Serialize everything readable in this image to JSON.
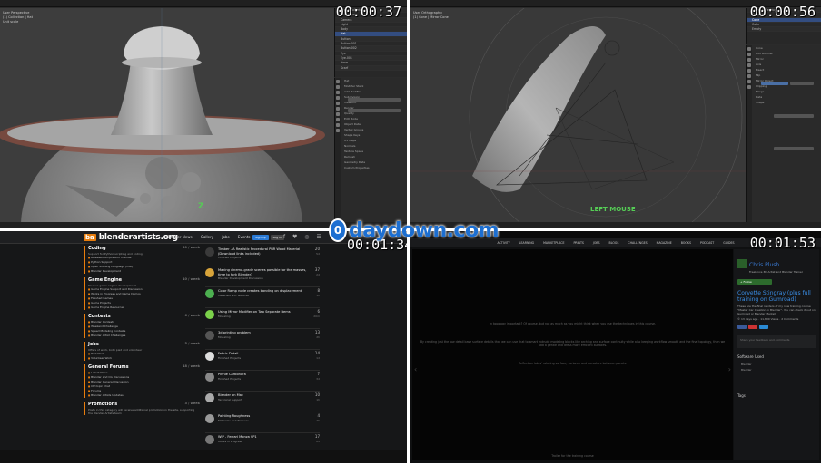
{
  "timestamps": [
    "00:00:37",
    "00:00:56",
    "00:01:34",
    "00:01:53"
  ],
  "watermark": {
    "glyph": "0",
    "text": "daydown.com"
  },
  "q1": {
    "menu": [
      "File",
      "Edit",
      "Render",
      "Window",
      "Help",
      "Layout",
      "Modeling",
      "Sculpting",
      "UV Editing",
      "Texture Paint",
      "Shading",
      "Animation",
      "Rendering",
      "Compositing",
      "Scripting"
    ],
    "viewport_info": [
      "User Perspective",
      "(1) Collection | Hat",
      "Unit scale"
    ],
    "gizmo_label": "Z",
    "outliner": [
      "Scene Collection",
      "Collection",
      "Camera",
      "Light",
      "Body",
      "Hat",
      "Button",
      "Button.001",
      "Button.002",
      "Eye",
      "Eye.001",
      "Nose",
      "Scarf"
    ],
    "properties": [
      "Hat",
      "Modifier Stack",
      "Add Modifier",
      "Subdivision",
      "Viewport",
      "Render",
      "Quality",
      "Edit Mode",
      "Object Data",
      "Vertex Groups",
      "Shape Keys",
      "UV Maps",
      "Normals",
      "Texture Space",
      "Remesh",
      "Geometry Data",
      "Custom Properties"
    ]
  },
  "q2": {
    "menu": [
      "File",
      "Edit",
      "Render",
      "Window",
      "Help",
      "Layout",
      "Modeling",
      "Sculpting",
      "UV Editing",
      "Texture Paint",
      "Shading",
      "Animation",
      "Rendering"
    ],
    "viewport_info": [
      "User Orthographic",
      "(1) Cone | Mirror Cone"
    ],
    "gizmo_label": "LEFT MOUSE",
    "outliner": [
      "Scene Collection",
      "Collection",
      "Cone",
      "Cube",
      "Empty"
    ],
    "properties": [
      "Cone",
      "Add Modifier",
      "Mirror",
      "Axis",
      "Bisect",
      "Flip",
      "Mirror Object",
      "Clipping",
      "Merge",
      "Data",
      "Shape"
    ]
  },
  "q3": {
    "logo_mark": "ba",
    "logo_text": "blenderartists.org",
    "nav": [
      "Blender News",
      "Gallery",
      "Jobs",
      "Events"
    ],
    "signup": "Sign Up",
    "login": "Log In",
    "social": "f ♥ ◎ ☰",
    "categories": [
      {
        "title": "Coding",
        "count": "20 / week",
        "desc": "Support for Python scripting and coding",
        "items": [
          "Released Scripts and Themes",
          "Python Support",
          "Open Shading Language (OSL)",
          "Blender Development"
        ]
      },
      {
        "title": "Game Engine",
        "count": "10 / week",
        "desc": "Discuss game engine development",
        "items": [
          "Game Engine Support and Discussion",
          "Works in Progress and Game Demos",
          "Finished Games",
          "Game Projects",
          "Game Engine Resources"
        ]
      },
      {
        "title": "Contests",
        "count": "6 / week",
        "desc": "",
        "items": [
          "Blender Contests",
          "Weekend Challenge",
          "Speed Modeling Contests",
          "Blender Artist Challenges"
        ]
      },
      {
        "title": "Jobs",
        "count": "5 / week",
        "desc": "Offers of work, both paid and volunteer",
        "items": [
          "Paid Work",
          "Volunteer Work"
        ]
      },
      {
        "title": "General Forums",
        "count": "18 / week",
        "desc": "",
        "items": [
          "Latest News",
          "Blender and CG Discussions",
          "Blender General Discussion",
          "Off-topic Chat",
          "Forums",
          "Blender Artists Updates"
        ]
      },
      {
        "title": "Promotions",
        "count": "3 / week",
        "desc": "Posts in this category will receive additional promotion on the site, supporting the Blender Artists team",
        "items": []
      }
    ],
    "topics": [
      {
        "title": "Timber - A Realistic Procedural PBR Wood Material (Download links included)",
        "cat": "Finished Projects",
        "count": "20",
        "age": "5d",
        "color": "#3a3a3a"
      },
      {
        "title": "Making cinema-grade scenes possible for the masses, time to fork Blender?",
        "cat": "Blender Development Discussion",
        "count": "37",
        "age": "2d",
        "color": "#d8a43a"
      },
      {
        "title": "Color Ramp node creates banding on displacement",
        "cat": "Materials and Textures",
        "count": "8",
        "age": "1h",
        "color": "#4caf50"
      },
      {
        "title": "Using Mirror Modifier on Two Separate Items",
        "cat": "Modeling",
        "count": "6",
        "age": "20m",
        "color": "#7bd14a"
      },
      {
        "title": "3d printing problem",
        "cat": "Modeling",
        "count": "13",
        "age": "2h",
        "color": "#555"
      },
      {
        "title": "Fabric Detail",
        "cat": "Finished Projects",
        "count": "14",
        "age": "1d",
        "color": "#ddd"
      },
      {
        "title": "Pinnie Carbonara",
        "cat": "Finished Projects",
        "count": "7",
        "age": "3d",
        "color": "#888"
      },
      {
        "title": "Blender on Mac",
        "cat": "Technical Support",
        "count": "10",
        "age": "1h",
        "color": "#aaa"
      },
      {
        "title": "Painting Roughness",
        "cat": "Materials and Textures",
        "count": "4",
        "age": "4h",
        "color": "#999"
      },
      {
        "title": "WIP - Ferrari Monza SP1",
        "cat": "Works in Progress",
        "count": "17",
        "age": "6d",
        "color": "#777"
      },
      {
        "title": "Price Chart Visualizer",
        "cat": "",
        "count": "",
        "age": "",
        "color": "#666"
      }
    ]
  },
  "q4": {
    "nav": [
      "ACTIVITY",
      "LEARNING",
      "MARKETPLACE",
      "PRINTS",
      "JOBS",
      "BLOGS",
      "CHALLENGES",
      "MAGAZINE",
      "BOOKS",
      "PODCAST",
      "GUIDES"
    ],
    "video_lines": [
      "In topology important? Of course, but not as much as you might think when you use the techniques in this course.",
      "By creating just the low detail base surface details that we can use that to smart extrude modeling blocks like arching and surface continuity while also keeping workflow smooth and the final topology, then we add a gentle and dress more efficient surfaces.",
      "Reflection lakes' rotating surface, variance and curvature between panels."
    ],
    "video_caption": "Trailer for the training course",
    "author_name": "Chris Plush",
    "author_sub": "Freelance 3D Artist and Blender Trainer",
    "follow_btn": "+ Follow",
    "course_title": "Corvette Stingray (plus full training on Gumroad)",
    "course_desc": "These are the final renders of my new training course \"Master Car Creation in Blender\". You can check it out on Gumroad or Blender Market.",
    "meta": "© 13 days ago  ·  11,830 Views  ·  2 Comments",
    "comment_placeholder": "Share your feedback and comments",
    "software_heading": "Software Used",
    "software": [
      "Blender",
      "Blender"
    ],
    "tags_heading": "Tags"
  }
}
